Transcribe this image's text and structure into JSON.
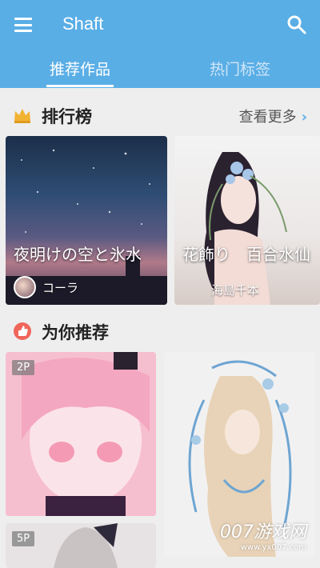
{
  "header": {
    "title": "Shaft",
    "menu_icon": "menu-icon",
    "search_icon": "search-icon",
    "tabs": [
      {
        "label": "推荐作品",
        "active": true
      },
      {
        "label": "热门标签",
        "active": false
      }
    ],
    "color": "#5aaee6"
  },
  "ranking": {
    "title": "排行榜",
    "icon": "crown-icon",
    "more_label": "查看更多",
    "more_chevron": "›",
    "cards": [
      {
        "title": "夜明けの空と氷水",
        "author": "コーラ"
      },
      {
        "title": "花飾り　百合水仙",
        "author": "海島千本"
      }
    ]
  },
  "recommend": {
    "title": "为你推荐",
    "icon": "thumbs-up-icon",
    "cards": [
      {
        "badge": "2P"
      },
      {
        "badge": ""
      },
      {
        "badge": "5P"
      }
    ]
  },
  "watermark": {
    "text": "007游戏网",
    "url": "www.yx007.com"
  }
}
